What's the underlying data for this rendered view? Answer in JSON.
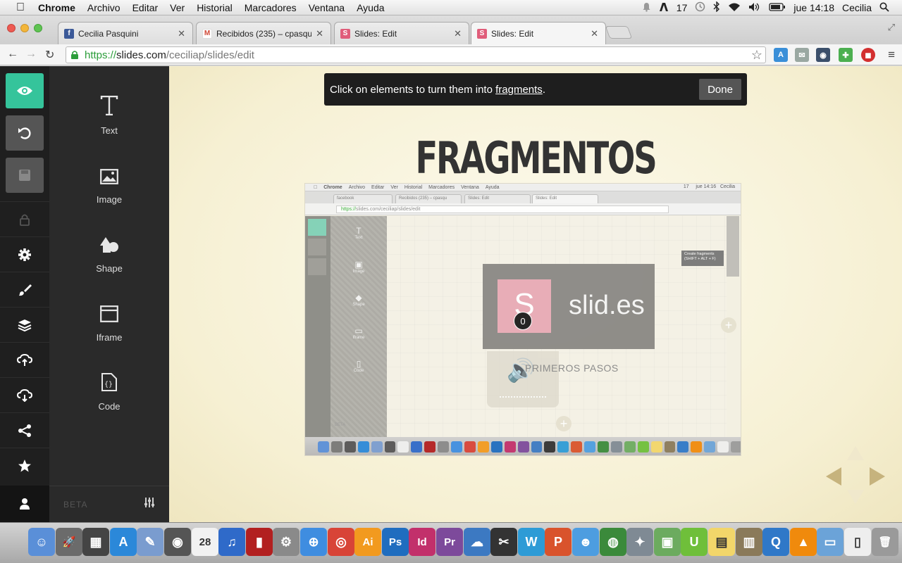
{
  "menubar": {
    "app": "Chrome",
    "items": [
      "Archivo",
      "Editar",
      "Ver",
      "Historial",
      "Marcadores",
      "Ventana",
      "Ayuda"
    ],
    "status": {
      "adobe_count": "17",
      "clock": "jue 14:18",
      "user": "Cecilia"
    }
  },
  "tabs": [
    {
      "label": "Cecilia Pasquini",
      "icon": "facebook-icon",
      "color": "#3b5998",
      "glyph": "f"
    },
    {
      "label": "Recibidos (235) – cpasquini",
      "icon": "gmail-icon",
      "color": "#d14836",
      "glyph": "M"
    },
    {
      "label": "Slides: Edit",
      "icon": "slides-icon",
      "color": "#e05d7a",
      "glyph": "S"
    },
    {
      "label": "Slides: Edit",
      "icon": "slides-icon",
      "color": "#e05d7a",
      "glyph": "S"
    }
  ],
  "address": {
    "scheme": "https://",
    "host": "slides.com",
    "path": "/ceciliap/slides/edit"
  },
  "editor": {
    "tools": [
      {
        "label": "Text",
        "icon": "text-icon"
      },
      {
        "label": "Image",
        "icon": "image-icon"
      },
      {
        "label": "Shape",
        "icon": "shape-icon"
      },
      {
        "label": "Iframe",
        "icon": "iframe-icon"
      },
      {
        "label": "Code",
        "icon": "code-icon"
      }
    ],
    "beta": "BETA",
    "notice_before": "Click on elements to turn them into ",
    "notice_link": "fragments",
    "notice_after": ".",
    "done_label": "Done",
    "slide_title": "FRAGMENTOS"
  },
  "shot": {
    "menubar_items": [
      "Chrome",
      "Archivo",
      "Editar",
      "Ver",
      "Historial",
      "Marcadores",
      "Ventana",
      "Ayuda"
    ],
    "menubar_right": "17     jue 14:16   Cecilia",
    "tabs": [
      "facebook",
      "Recibidos (235) – cpasqu",
      "Slides: Edit",
      "Slides: Edit"
    ],
    "url_scheme": "https://",
    "url_rest": "slides.com/ceciliap/slides/edit",
    "tools": [
      "Text",
      "Image",
      "Shape",
      "Iframe",
      "Code"
    ],
    "tooltip": "Create fragments (SHIFT + ALT + F)",
    "logo_letter": "S",
    "fragment_index": "0",
    "logo_text": "slid.es",
    "subtitle": "PRIMEROS PASOS",
    "beta": "BETA"
  },
  "dock": {
    "items": [
      {
        "icon": "finder-icon",
        "color": "#5a8fd8",
        "glyph": "☺"
      },
      {
        "icon": "launchpad-icon",
        "color": "#6b6b6b",
        "glyph": "🚀"
      },
      {
        "icon": "dashboard-icon",
        "color": "#444",
        "glyph": "▦"
      },
      {
        "icon": "app-store-icon",
        "color": "#2b88d9",
        "glyph": "A"
      },
      {
        "icon": "preview-icon",
        "color": "#7a9ccf",
        "glyph": "✎"
      },
      {
        "icon": "facetime-icon",
        "color": "#555",
        "glyph": "◉"
      },
      {
        "icon": "calendar-icon",
        "color": "#f2f2f2",
        "glyph": "28"
      },
      {
        "icon": "itunes-icon",
        "color": "#2f6ac9",
        "glyph": "♫"
      },
      {
        "icon": "photo-booth-icon",
        "color": "#b22020",
        "glyph": "▮"
      },
      {
        "icon": "system-preferences-icon",
        "color": "#8a8a8a",
        "glyph": "⚙"
      },
      {
        "icon": "safari-icon",
        "color": "#3f8de0",
        "glyph": "⊕"
      },
      {
        "icon": "chrome-icon",
        "color": "#d84437",
        "glyph": "◎"
      },
      {
        "icon": "illustrator-icon",
        "color": "#f29a1f",
        "glyph": "Ai"
      },
      {
        "icon": "photoshop-icon",
        "color": "#1f6dbf",
        "glyph": "Ps"
      },
      {
        "icon": "indesign-icon",
        "color": "#c2306b",
        "glyph": "Id"
      },
      {
        "icon": "premiere-icon",
        "color": "#7d4a9b",
        "glyph": "Pr"
      },
      {
        "icon": "vpn-icon",
        "color": "#3c79c2",
        "glyph": "☁"
      },
      {
        "icon": "final-cut-icon",
        "color": "#333",
        "glyph": "✂"
      },
      {
        "icon": "word-icon",
        "color": "#2d9bd6",
        "glyph": "W"
      },
      {
        "icon": "powerpoint-icon",
        "color": "#d9532c",
        "glyph": "P"
      },
      {
        "icon": "messenger-icon",
        "color": "#4d9de0",
        "glyph": "☻"
      },
      {
        "icon": "globe-icon",
        "color": "#3b8a3b",
        "glyph": "◍"
      },
      {
        "icon": "network-icon",
        "color": "#7f8a94",
        "glyph": "✦"
      },
      {
        "icon": "image-viewer-icon",
        "color": "#6cab5f",
        "glyph": "▣"
      },
      {
        "icon": "evernote-icon",
        "color": "#6fbf3a",
        "glyph": "U"
      },
      {
        "icon": "stickies-icon",
        "color": "#f2d66a",
        "glyph": "▤"
      },
      {
        "icon": "notes-icon",
        "color": "#8a7a5a",
        "glyph": "▥"
      },
      {
        "icon": "quicktime-icon",
        "color": "#2f78c8",
        "glyph": "Q"
      },
      {
        "icon": "vlc-icon",
        "color": "#f08a0c",
        "glyph": "▲"
      },
      {
        "icon": "folder-icon",
        "color": "#6ba3d8",
        "glyph": "▭"
      },
      {
        "icon": "document-icon",
        "color": "#eeeeee",
        "glyph": "▯"
      },
      {
        "icon": "trash-icon",
        "color": "#9a9a9a",
        "glyph": "🗑"
      }
    ]
  }
}
